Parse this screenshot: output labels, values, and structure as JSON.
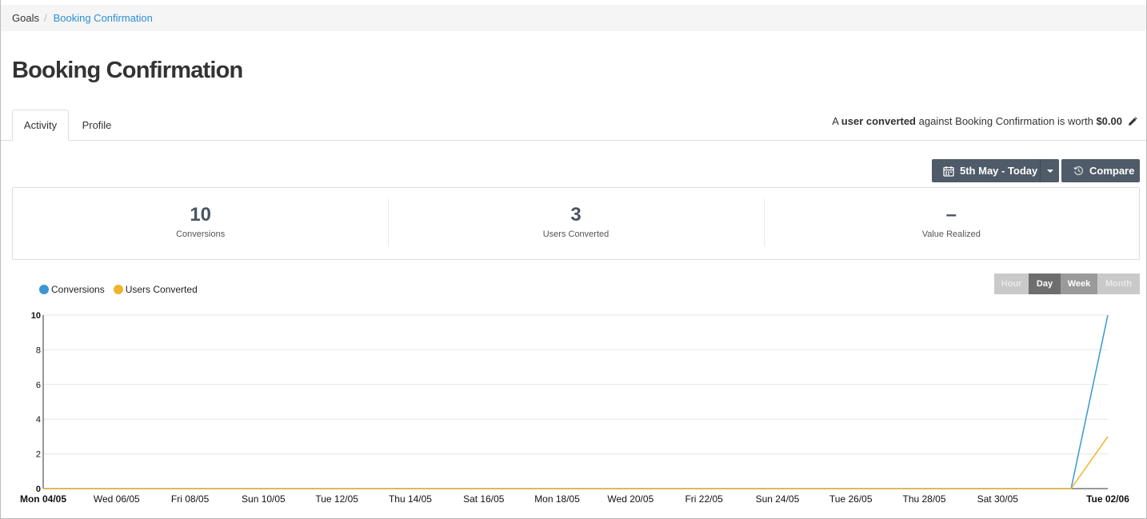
{
  "breadcrumb": {
    "root": "Goals",
    "separator": "/",
    "current": "Booking Confirmation"
  },
  "page": {
    "title": "Booking Confirmation"
  },
  "tabs": [
    {
      "label": "Activity",
      "active": true
    },
    {
      "label": "Profile",
      "active": false
    }
  ],
  "worth": {
    "prefix": "A ",
    "bold1": "user converted",
    "middle": " against Booking Confirmation is worth ",
    "value": "$0.00",
    "edit_icon": "pencil-icon"
  },
  "toolbar": {
    "date_range": "5th May - Today",
    "date_icon": "calendar-icon",
    "compare": "Compare",
    "compare_icon": "history-icon"
  },
  "stats": [
    {
      "value": "10",
      "label": "Conversions"
    },
    {
      "value": "3",
      "label": "Users Converted"
    },
    {
      "value": "–",
      "label": "Value Realized"
    }
  ],
  "granularity": [
    {
      "label": "Hour",
      "state": "disabled"
    },
    {
      "label": "Day",
      "state": "active"
    },
    {
      "label": "Week",
      "state": "enabled"
    },
    {
      "label": "Month",
      "state": "disabled"
    }
  ],
  "colors": {
    "conversions": "#3b97d3",
    "users_converted": "#f0b42d",
    "button": "#4f5b69",
    "link": "#2a8fd6"
  },
  "chart_data": {
    "type": "line",
    "x_tick_labels": [
      "Mon 04/05",
      "Wed 06/05",
      "Fri 08/05",
      "Sun 10/05",
      "Tue 12/05",
      "Thu 14/05",
      "Sat 16/05",
      "Mon 18/05",
      "Wed 20/05",
      "Fri 22/05",
      "Sun 24/05",
      "Tue 26/05",
      "Thu 28/05",
      "Sat 30/05",
      "Tue 02/06"
    ],
    "x_tick_bold": [
      "Mon 04/05",
      "Tue 02/06"
    ],
    "y_ticks": [
      0,
      2,
      4,
      6,
      8,
      10
    ],
    "ylim": [
      0,
      10
    ],
    "grid": true,
    "legend": "top-left",
    "x_dates": [
      "04/05",
      "05/05",
      "06/05",
      "07/05",
      "08/05",
      "09/05",
      "10/05",
      "11/05",
      "12/05",
      "13/05",
      "14/05",
      "15/05",
      "16/05",
      "17/05",
      "18/05",
      "19/05",
      "20/05",
      "21/05",
      "22/05",
      "23/05",
      "24/05",
      "25/05",
      "26/05",
      "27/05",
      "28/05",
      "29/05",
      "30/05",
      "31/05",
      "01/06",
      "02/06"
    ],
    "series": [
      {
        "name": "Conversions",
        "values": [
          0,
          0,
          0,
          0,
          0,
          0,
          0,
          0,
          0,
          0,
          0,
          0,
          0,
          0,
          0,
          0,
          0,
          0,
          0,
          0,
          0,
          0,
          0,
          0,
          0,
          0,
          0,
          0,
          0,
          10
        ]
      },
      {
        "name": "Users Converted",
        "values": [
          0,
          0,
          0,
          0,
          0,
          0,
          0,
          0,
          0,
          0,
          0,
          0,
          0,
          0,
          0,
          0,
          0,
          0,
          0,
          0,
          0,
          0,
          0,
          0,
          0,
          0,
          0,
          0,
          0,
          3
        ]
      }
    ]
  }
}
